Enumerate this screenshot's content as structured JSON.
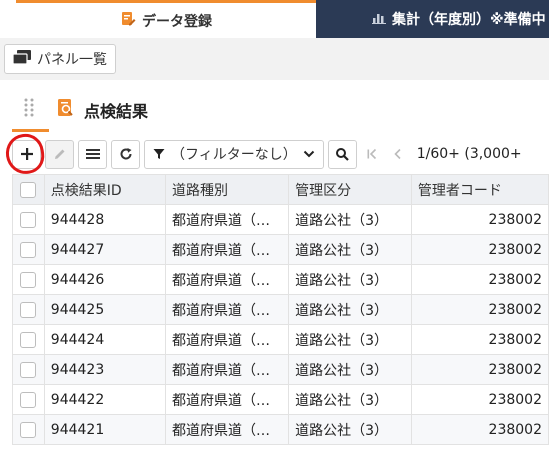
{
  "tabs": [
    {
      "label": "データ登録",
      "icon": "edit-document-icon",
      "active": true
    },
    {
      "label": "集計（年度別）※準備中",
      "icon": "bar-chart-icon",
      "active": false
    }
  ],
  "panel_list_button": {
    "label": "パネル一覧",
    "icon": "window-icon"
  },
  "panel": {
    "title": "点検結果",
    "icon": "inspection-search-icon"
  },
  "toolbar": {
    "filter_label": "（フィルターなし）",
    "pager_text": "1/60+ (3,000+"
  },
  "table": {
    "columns": [
      "点検結果ID",
      "道路種別",
      "管理区分",
      "管理者コード"
    ],
    "rows": [
      [
        "944428",
        "都道府県道（…",
        "道路公社（3）",
        "238002"
      ],
      [
        "944427",
        "都道府県道（…",
        "道路公社（3）",
        "238002"
      ],
      [
        "944426",
        "都道府県道（…",
        "道路公社（3）",
        "238002"
      ],
      [
        "944425",
        "都道府県道（…",
        "道路公社（3）",
        "238002"
      ],
      [
        "944424",
        "都道府県道（…",
        "道路公社（3）",
        "238002"
      ],
      [
        "944423",
        "都道府県道（…",
        "道路公社（3）",
        "238002"
      ],
      [
        "944422",
        "都道府県道（…",
        "道路公社（3）",
        "238002"
      ],
      [
        "944421",
        "都道府県道（…",
        "道路公社（3）",
        "238002"
      ]
    ]
  },
  "colors": {
    "accent": "#f08c2e",
    "nav_dark": "#2b3a55",
    "annotation": "#e01818"
  }
}
